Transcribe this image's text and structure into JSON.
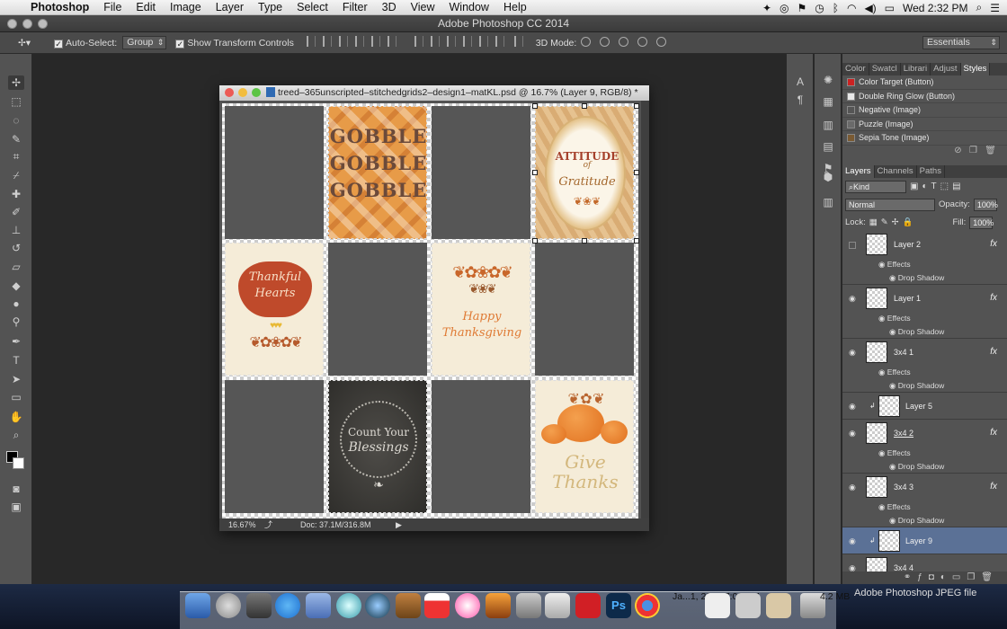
{
  "menubar": {
    "app": "Photoshop",
    "items": [
      "File",
      "Edit",
      "Image",
      "Layer",
      "Type",
      "Select",
      "Filter",
      "3D",
      "View",
      "Window",
      "Help"
    ],
    "clock": "Wed 2:32 PM"
  },
  "app_title": "Adobe Photoshop CC 2014",
  "options": {
    "auto_select_label": "Auto-Select:",
    "auto_select_value": "Group",
    "transform_label": "Show Transform Controls",
    "mode3d_label": "3D Mode:",
    "workspace": "Essentials"
  },
  "document": {
    "title": "treed–365unscripted–stitchedgrids2–design1–matKL.psd @ 16.7% (Layer 9, RGB/8) *",
    "zoom": "16.67%",
    "doc_size": "Doc: 37.1M/316.8M",
    "cards": {
      "gobble": "GOBBLE",
      "attitude": "ATTITUDE",
      "of": "of",
      "gratitude": "Gratitude",
      "thankful1": "Thankful",
      "thankful2": "Hearts",
      "happy": "Happy",
      "thanksgiving": "Thanksgiving",
      "count1": "Count Your",
      "count2": "Blessings",
      "give": "Give",
      "thanks": "Thanks"
    }
  },
  "styles_panel": {
    "tabs": [
      "Color",
      "Swatcl",
      "Librari",
      "Adjust",
      "Styles"
    ],
    "active_tab": "Styles",
    "items": [
      {
        "label": "Color Target (Button)",
        "color": "#cc2222"
      },
      {
        "label": "Double Ring Glow (Button)",
        "color": "#e8e8e8"
      },
      {
        "label": "Negative (Image)",
        "color": "#555555"
      },
      {
        "label": "Puzzle (Image)",
        "color": "#6a6a6a"
      },
      {
        "label": "Sepia Tone (Image)",
        "color": "#7a5a32"
      }
    ]
  },
  "layers_panel": {
    "tabs": [
      "Layers",
      "Channels",
      "Paths"
    ],
    "kind": "Kind",
    "blend_mode": "Normal",
    "opacity_label": "Opacity:",
    "opacity": "100%",
    "lock_label": "Lock:",
    "fill_label": "Fill:",
    "fill": "100%",
    "effects_label": "Effects",
    "drop_shadow_label": "Drop Shadow",
    "layers": [
      {
        "name": "Layer 2",
        "fx": "fx",
        "effects": true
      },
      {
        "name": "Layer 1",
        "fx": "fx",
        "effects": true
      },
      {
        "name": "3x4 1",
        "fx": "fx",
        "effects": true
      },
      {
        "name": "Layer 5",
        "fx": "",
        "effects": false
      },
      {
        "name": "3x4 2",
        "fx": "fx",
        "effects": true
      },
      {
        "name": "3x4 3",
        "fx": "fx",
        "effects": true
      },
      {
        "name": "Layer 9",
        "fx": "",
        "effects": false
      },
      {
        "name": "3x4 4",
        "fx": "",
        "effects": false
      }
    ]
  },
  "dock": {
    "status_text": "Adobe Photoshop JPEG file",
    "file_date": "Ja...1, 2016 7:03 PM",
    "file_size": "4.2 MB"
  }
}
